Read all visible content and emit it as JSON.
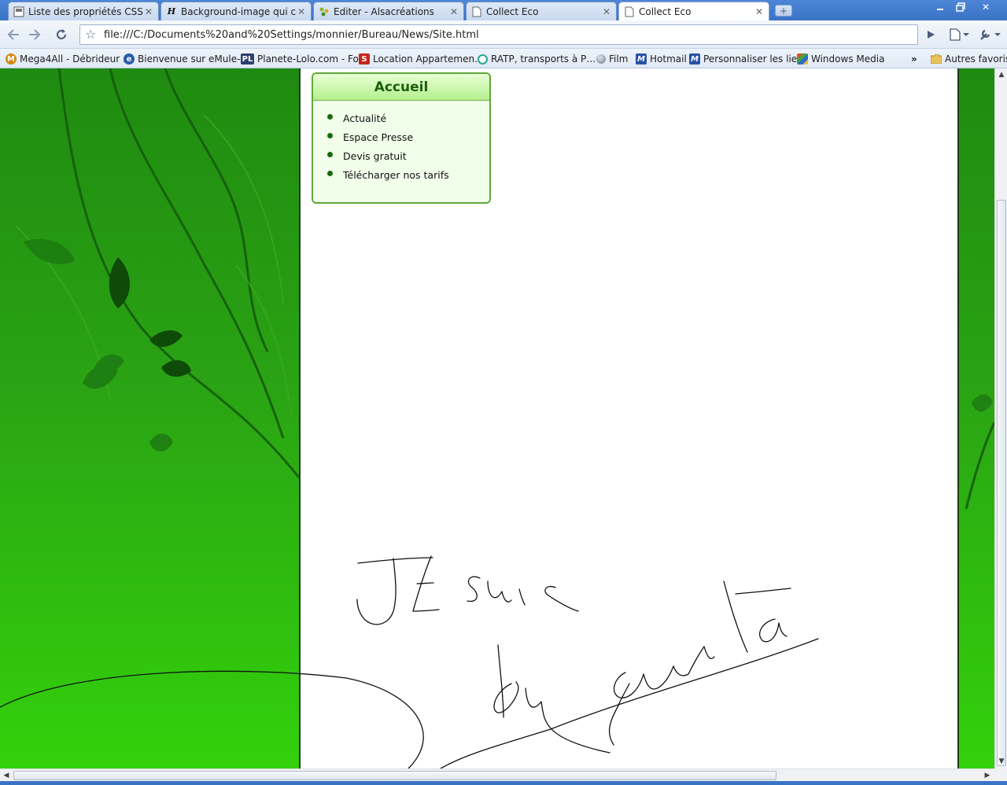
{
  "tabs": [
    {
      "title": "Liste des propriétés CSS",
      "icon": "page-icon",
      "active": false
    },
    {
      "title": "Background-image qui couv…",
      "icon": "h-logo-icon",
      "active": false
    },
    {
      "title": "Editer - Alsacréations",
      "icon": "alsacreations-icon",
      "active": false
    },
    {
      "title": "Collect Eco",
      "icon": "blank-page-icon",
      "active": false
    },
    {
      "title": "Collect Eco",
      "icon": "blank-page-icon",
      "active": true
    }
  ],
  "toolbar": {
    "url": "file:///C:/Documents%20and%20Settings/monnier/Bureau/News/Site.html"
  },
  "bookmarks": {
    "items": [
      {
        "label": "Mega4All - Débrideur …",
        "icon": "mega4all-icon",
        "color": "#d28a12"
      },
      {
        "label": "Bienvenue sur eMule-…",
        "icon": "emule-icon",
        "color": "#2a5cab"
      },
      {
        "label": "Planete-Lolo.com - Fo…",
        "icon": "pl-icon",
        "color": "#2c3f6e"
      },
      {
        "label": "Location Appartemen…",
        "icon": "location-icon",
        "color": "#c4261c"
      },
      {
        "label": "RATP, transports à P…",
        "icon": "ratp-icon",
        "color": "#2aa58f"
      },
      {
        "label": "Film",
        "icon": "globe-icon",
        "color": "#7a8798"
      },
      {
        "label": "Hotmail",
        "icon": "msn-icon",
        "color": "#2753a6"
      },
      {
        "label": "Personnaliser les liens",
        "icon": "msn-icon",
        "color": "#2753a6"
      },
      {
        "label": "Windows Media",
        "icon": "windows-icon",
        "color": "#e0862a"
      }
    ],
    "overflow": "»",
    "other_folder": "Autres favoris"
  },
  "page": {
    "menu": {
      "title": "Accueil",
      "items": [
        "Actualité",
        "Espace Presse",
        "Devis gratuit",
        "Télécharger nos tarifs"
      ]
    },
    "handwriting": "JE suis Toujours Ta",
    "colors": {
      "menu_border": "#5fa838",
      "menu_title": "#1d5f0c",
      "bg_green": "#2aa314"
    }
  }
}
